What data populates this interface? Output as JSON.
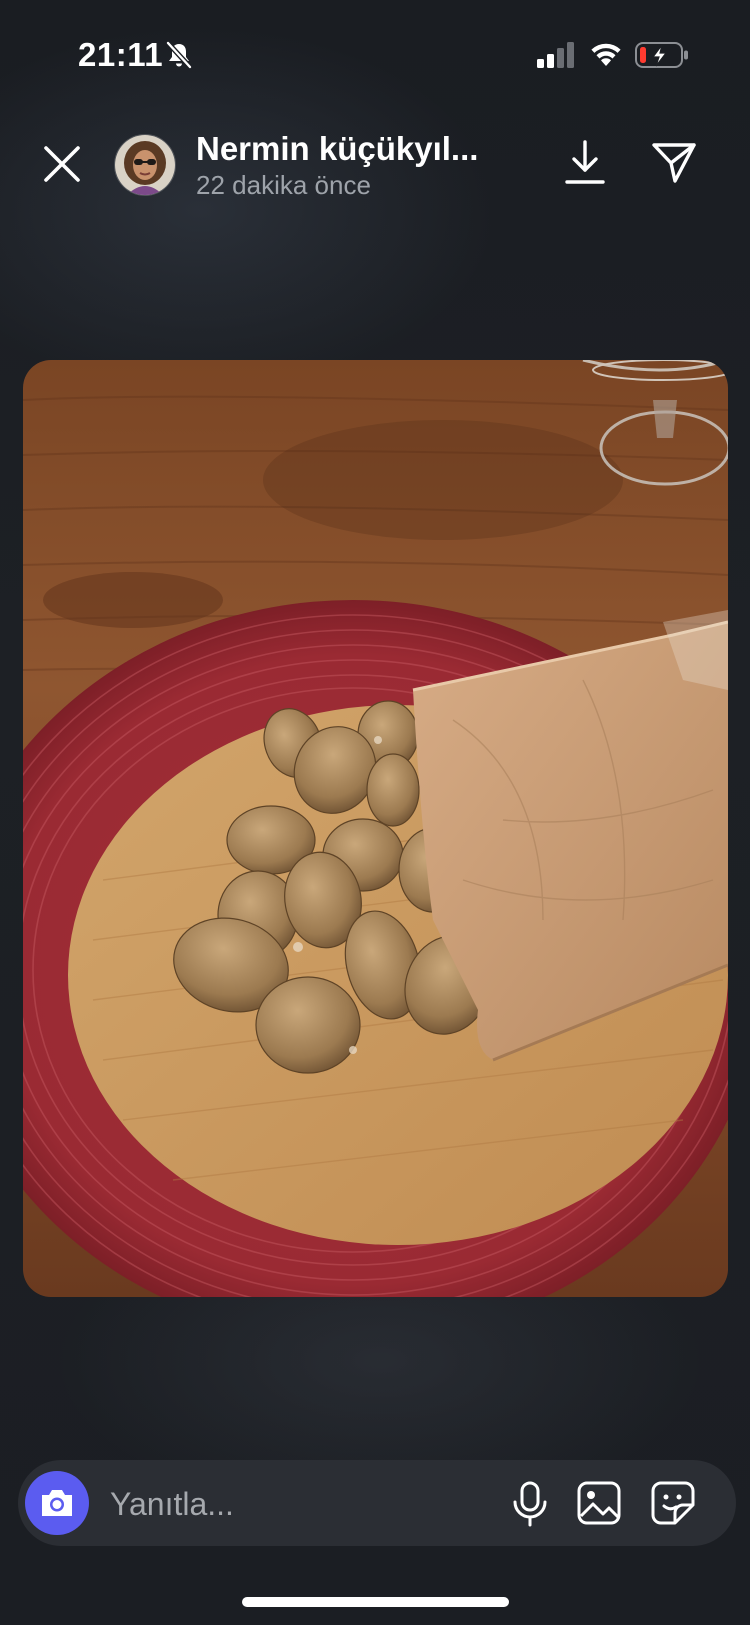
{
  "status_bar": {
    "time": "21:11",
    "icons": [
      "bell-slash-icon",
      "cellular-signal-icon",
      "wifi-icon",
      "battery-charging-icon"
    ]
  },
  "story": {
    "username": "Nermin küçükyıl...",
    "timestamp": "22 dakika önce",
    "icons": [
      "close-icon",
      "download-icon",
      "share-paper-plane-icon"
    ]
  },
  "photo": {
    "subject": "dried figs on a bamboo board with a kraft paper bag on a red round placemat"
  },
  "reply": {
    "placeholder": "Yanıtla...",
    "icons": [
      "camera-icon",
      "microphone-icon",
      "gallery-icon",
      "sticker-icon"
    ]
  },
  "colors": {
    "background": "#1c1f24",
    "accent": "#5b5cf0",
    "battery_low": "#ff3b30",
    "muted_text": "#9ea3aa"
  }
}
